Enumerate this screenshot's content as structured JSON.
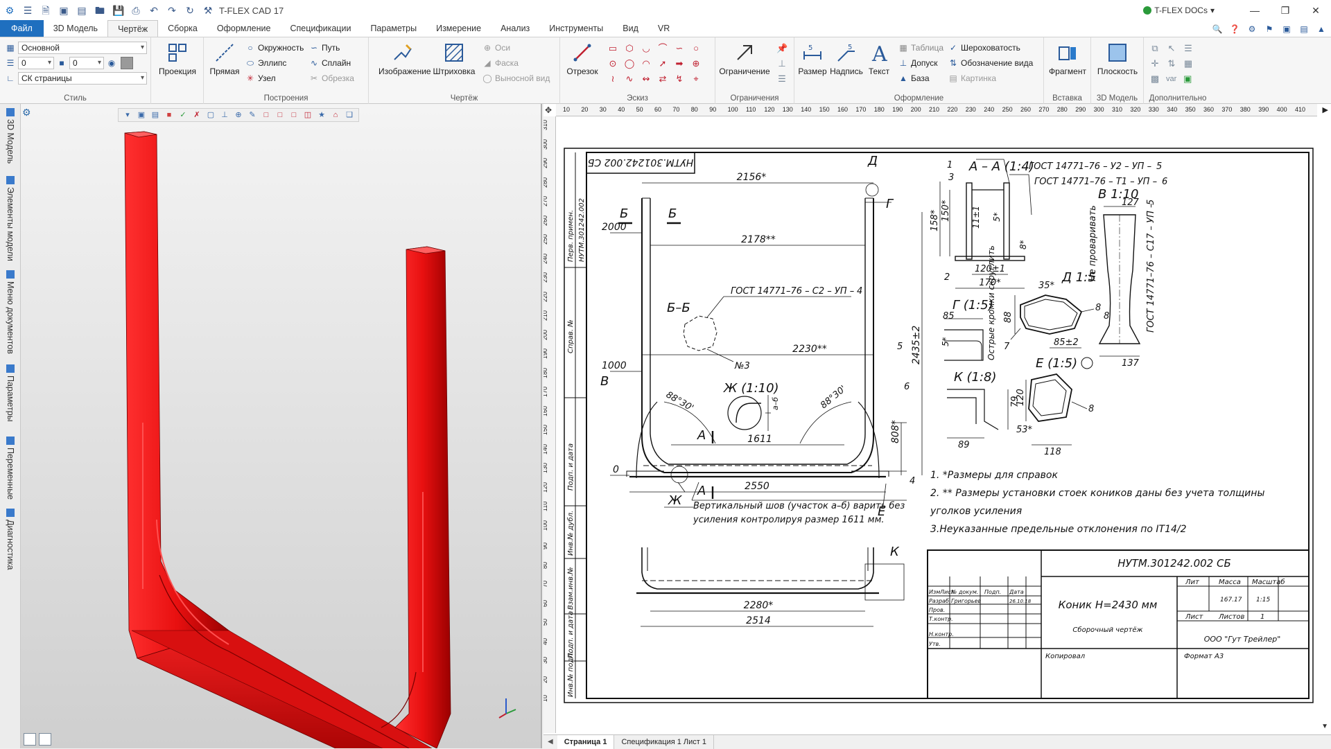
{
  "app": {
    "title": "T-FLEX CAD 17",
    "docs_label": "T-FLEX DOCs"
  },
  "menu": {
    "file": "Файл",
    "tabs": [
      "3D Модель",
      "Чертёж",
      "Сборка",
      "Оформление",
      "Спецификации",
      "Параметры",
      "Измерение",
      "Анализ",
      "Инструменты",
      "Вид",
      "VR"
    ],
    "active": "Чертёж"
  },
  "ribbon": {
    "style": {
      "label": "Стиль",
      "layer": "Основной",
      "num1": "0",
      "num2": "0",
      "cs": "СК страницы"
    },
    "projection": {
      "label": "Проекция"
    },
    "build": {
      "label": "Построения",
      "line": "Прямая",
      "items": [
        "Окружность",
        "Эллипс",
        "Узел",
        "Путь",
        "Сплайн",
        "Обрезка"
      ]
    },
    "drawing": {
      "label": "Чертёж",
      "image": "Изображение",
      "hatch": "Штриховка",
      "axes": "Оси",
      "chamfer": "Фаска",
      "detail": "Выносной вид"
    },
    "sketch": {
      "label": "Эскиз",
      "segment": "Отрезок"
    },
    "constraints": {
      "label": "Ограничения",
      "constraint": "Ограничение"
    },
    "format": {
      "label": "Оформление",
      "dimension": "Размер",
      "note": "Надпись",
      "text": "Текст",
      "table": "Таблица",
      "tolerance": "Допуск",
      "base": "База",
      "roughness": "Шероховатость",
      "view_mark": "Обозначение вида",
      "picture": "Картинка"
    },
    "insert": {
      "label": "Вставка",
      "fragment": "Фрагмент"
    },
    "model3d": {
      "label": "3D Модель",
      "plane": "Плоскость"
    },
    "extra": {
      "label": "Дополнительно",
      "var": "var"
    }
  },
  "left_tabs": [
    "3D Модель",
    "Элементы модели",
    "Меню документов",
    "Параметры",
    "Переменные",
    "Диагностика"
  ],
  "ruler": {
    "h": [
      "10",
      "20",
      "30",
      "40",
      "50",
      "60",
      "70",
      "80",
      "90",
      "100",
      "110",
      "120",
      "130",
      "140",
      "150",
      "160",
      "170",
      "180",
      "190",
      "200",
      "210",
      "220",
      "230",
      "240",
      "250",
      "260",
      "270",
      "280",
      "290",
      "300",
      "310",
      "320",
      "330",
      "340",
      "350",
      "360",
      "370",
      "380",
      "390",
      "400",
      "410"
    ],
    "v": [
      "310",
      "300",
      "290",
      "280",
      "270",
      "260",
      "250",
      "240",
      "230",
      "220",
      "210",
      "200",
      "190",
      "180",
      "170",
      "160",
      "150",
      "140",
      "130",
      "120",
      "110",
      "100",
      "90",
      "80",
      "70",
      "60",
      "50",
      "40",
      "30",
      "20",
      "10"
    ]
  },
  "drawing": {
    "stamp_top": "НУТМ.301242.002 СБ",
    "side_labels": [
      "Перв. примен.",
      "НУТМ.301242.002",
      "Справ. №",
      "Подп. и дата",
      "Инв.№ дубл.",
      "Взам.инв.№",
      "Подп. и дата",
      "Инв.№ подл."
    ],
    "dims": {
      "d2156": "2156*",
      "d2178": "2178**",
      "d2230": "2230**",
      "d1611": "1611",
      "d2550": "2550",
      "d2280": "2280*",
      "d2514": "2514",
      "d2000": "2000",
      "d1000": "1000",
      "d0": "0",
      "d2435": "2435±2",
      "d808": "808*",
      "a1": "88°30'",
      "a2": "88°30'"
    },
    "letters": {
      "D": "Д",
      "G": "Г",
      "B1": "Б",
      "B2": "Б",
      "V": "В",
      "A1": "А",
      "A2": "А",
      "Zh": "Ж",
      "E": "Е",
      "K": "К"
    },
    "callouts": {
      "c4": "4",
      "c5": "5",
      "c6": "6",
      "c1": "1",
      "c2": "2",
      "c3": "3",
      "c8a": "8",
      "c8b": "8",
      "c8c": "8",
      "c7": "7",
      "n3": "№3"
    },
    "section_bb": "Б–Б",
    "weld1": "ГОСТ 14771–76 – С2 – УП –",
    "weld1_leg": "4",
    "zh": "Ж (1:10)",
    "ab": "а–б",
    "note_weld": [
      "Вертикальный шов (участок а–б) варить без",
      "усиления контролируя размер 1611 мм."
    ],
    "aa": {
      "title": "А – А (1:4)",
      "g1": "ГОСТ 14771–76 – У2 – УП –",
      "g1_leg": "5",
      "g2": "ГОСТ 14771–76 – Т1 – УП –",
      "g2_leg": "6",
      "d158": "158*",
      "d150": "150*",
      "d11": "11±1",
      "d5": "5*",
      "d8": "8*",
      "d120": "120±1",
      "d170": "170*"
    },
    "v110": {
      "title": "В 1:10",
      "d127": "127",
      "d137": "137",
      "gost": "ГОСТ 14771–76 – С17 – УП –",
      "gost_leg": "5",
      "no_weld": "Не проваривать"
    },
    "g15": {
      "title": "Г (1:5)",
      "d85": "85",
      "d5": "5*",
      "note": "Острые кромки скруглить"
    },
    "d15": {
      "title": "Д 1:5",
      "d35": "35*",
      "d88": "88",
      "d85": "85±2"
    },
    "k18": {
      "title": "К (1:8)",
      "d79": "79",
      "d89": "89"
    },
    "e15": {
      "title": "Е (1:5)",
      "d120": "120",
      "d53": "53*",
      "d118": "118"
    },
    "notes": [
      "1.  *Размеры для справок",
      "2. ** Размеры установки стоек коников даны без учета толщины",
      "уголков усиления",
      "3.Неуказанные предельные отклонения по IT14/2"
    ],
    "tb": {
      "code": "НУТМ.301242.002 СБ",
      "name": "Коник H=2430 мм",
      "type": "Сборочный чертёж",
      "lit": "Лит",
      "mass": "Масса",
      "scale": "Масштаб",
      "mass_v": "167.17",
      "scale_v": "1:15",
      "sheet": "Лист",
      "sheets": "Листов",
      "sheets_v": "1",
      "org": "ООО \"Гут Трейлер\"",
      "copy": "Копировал",
      "format": "Формат",
      "format_v": "А3",
      "h_izm": "Изм",
      "h_list": "Лист",
      "h_doc": "№ докум.",
      "h_podp": "Подп.",
      "h_data": "Дата",
      "razrab": "Разраб.",
      "author": "Григорьев",
      "date": "26.10.18",
      "prov": "Пров.",
      "tkontr": "Т.контр.",
      "nkontr": "Н.контр.",
      "utv": "Утв."
    }
  },
  "pages": [
    "Страница 1",
    "Спецификация 1 Лист 1"
  ],
  "colors": {
    "part": "#e01010",
    "ribbon_file": "#1f6fbf"
  }
}
